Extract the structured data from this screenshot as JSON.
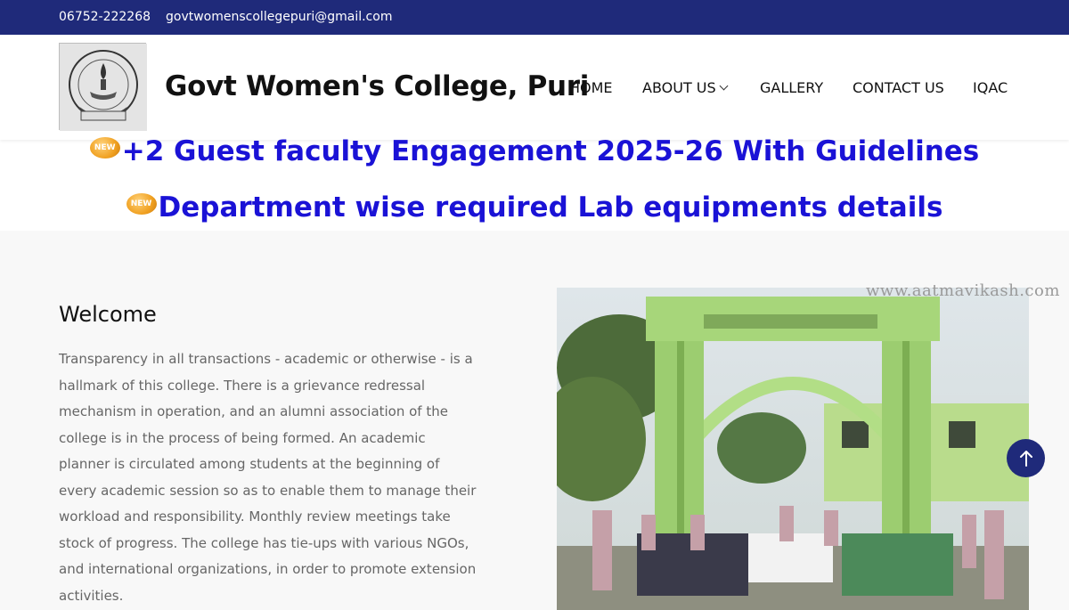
{
  "topbar": {
    "phone": "06752-222268",
    "email": "govtwomenscollegepuri@gmail.com"
  },
  "header": {
    "site_title": "Govt Women's College, Puri",
    "nav": {
      "home": "HOME",
      "about": "ABOUT US",
      "gallery": "GALLERY",
      "contact": "CONTACT US",
      "iqac": "IQAC"
    }
  },
  "notices": {
    "badge": "NEW",
    "item_1": "+2 Guest faculty Engagement 2025-26 With Guidelines",
    "item_2": "Department wise required Lab equipments details"
  },
  "welcome": {
    "title": "Welcome",
    "text": "Transparency in all transactions - academic or otherwise - is a hallmark of this college. There is a grievance redressal mechanism in operation, and an alumni association of the college is in the process of being formed. An academic planner is circulated among students at the beginning of every academic session so as to enable them to manage their workload and responsibility. Monthly review meetings take stock of progress. The college has tie-ups with various NGOs, and international organizations, in order to promote extension activities."
  },
  "photo": {
    "watermark": "www.aatmavikash.com"
  },
  "colors": {
    "brand_navy": "#1f2a7a",
    "notice_blue": "#1a12d6"
  },
  "icons": {
    "scroll_top": "arrow-up-icon",
    "dropdown": "chevron-down-icon",
    "new": "new-badge-icon"
  }
}
